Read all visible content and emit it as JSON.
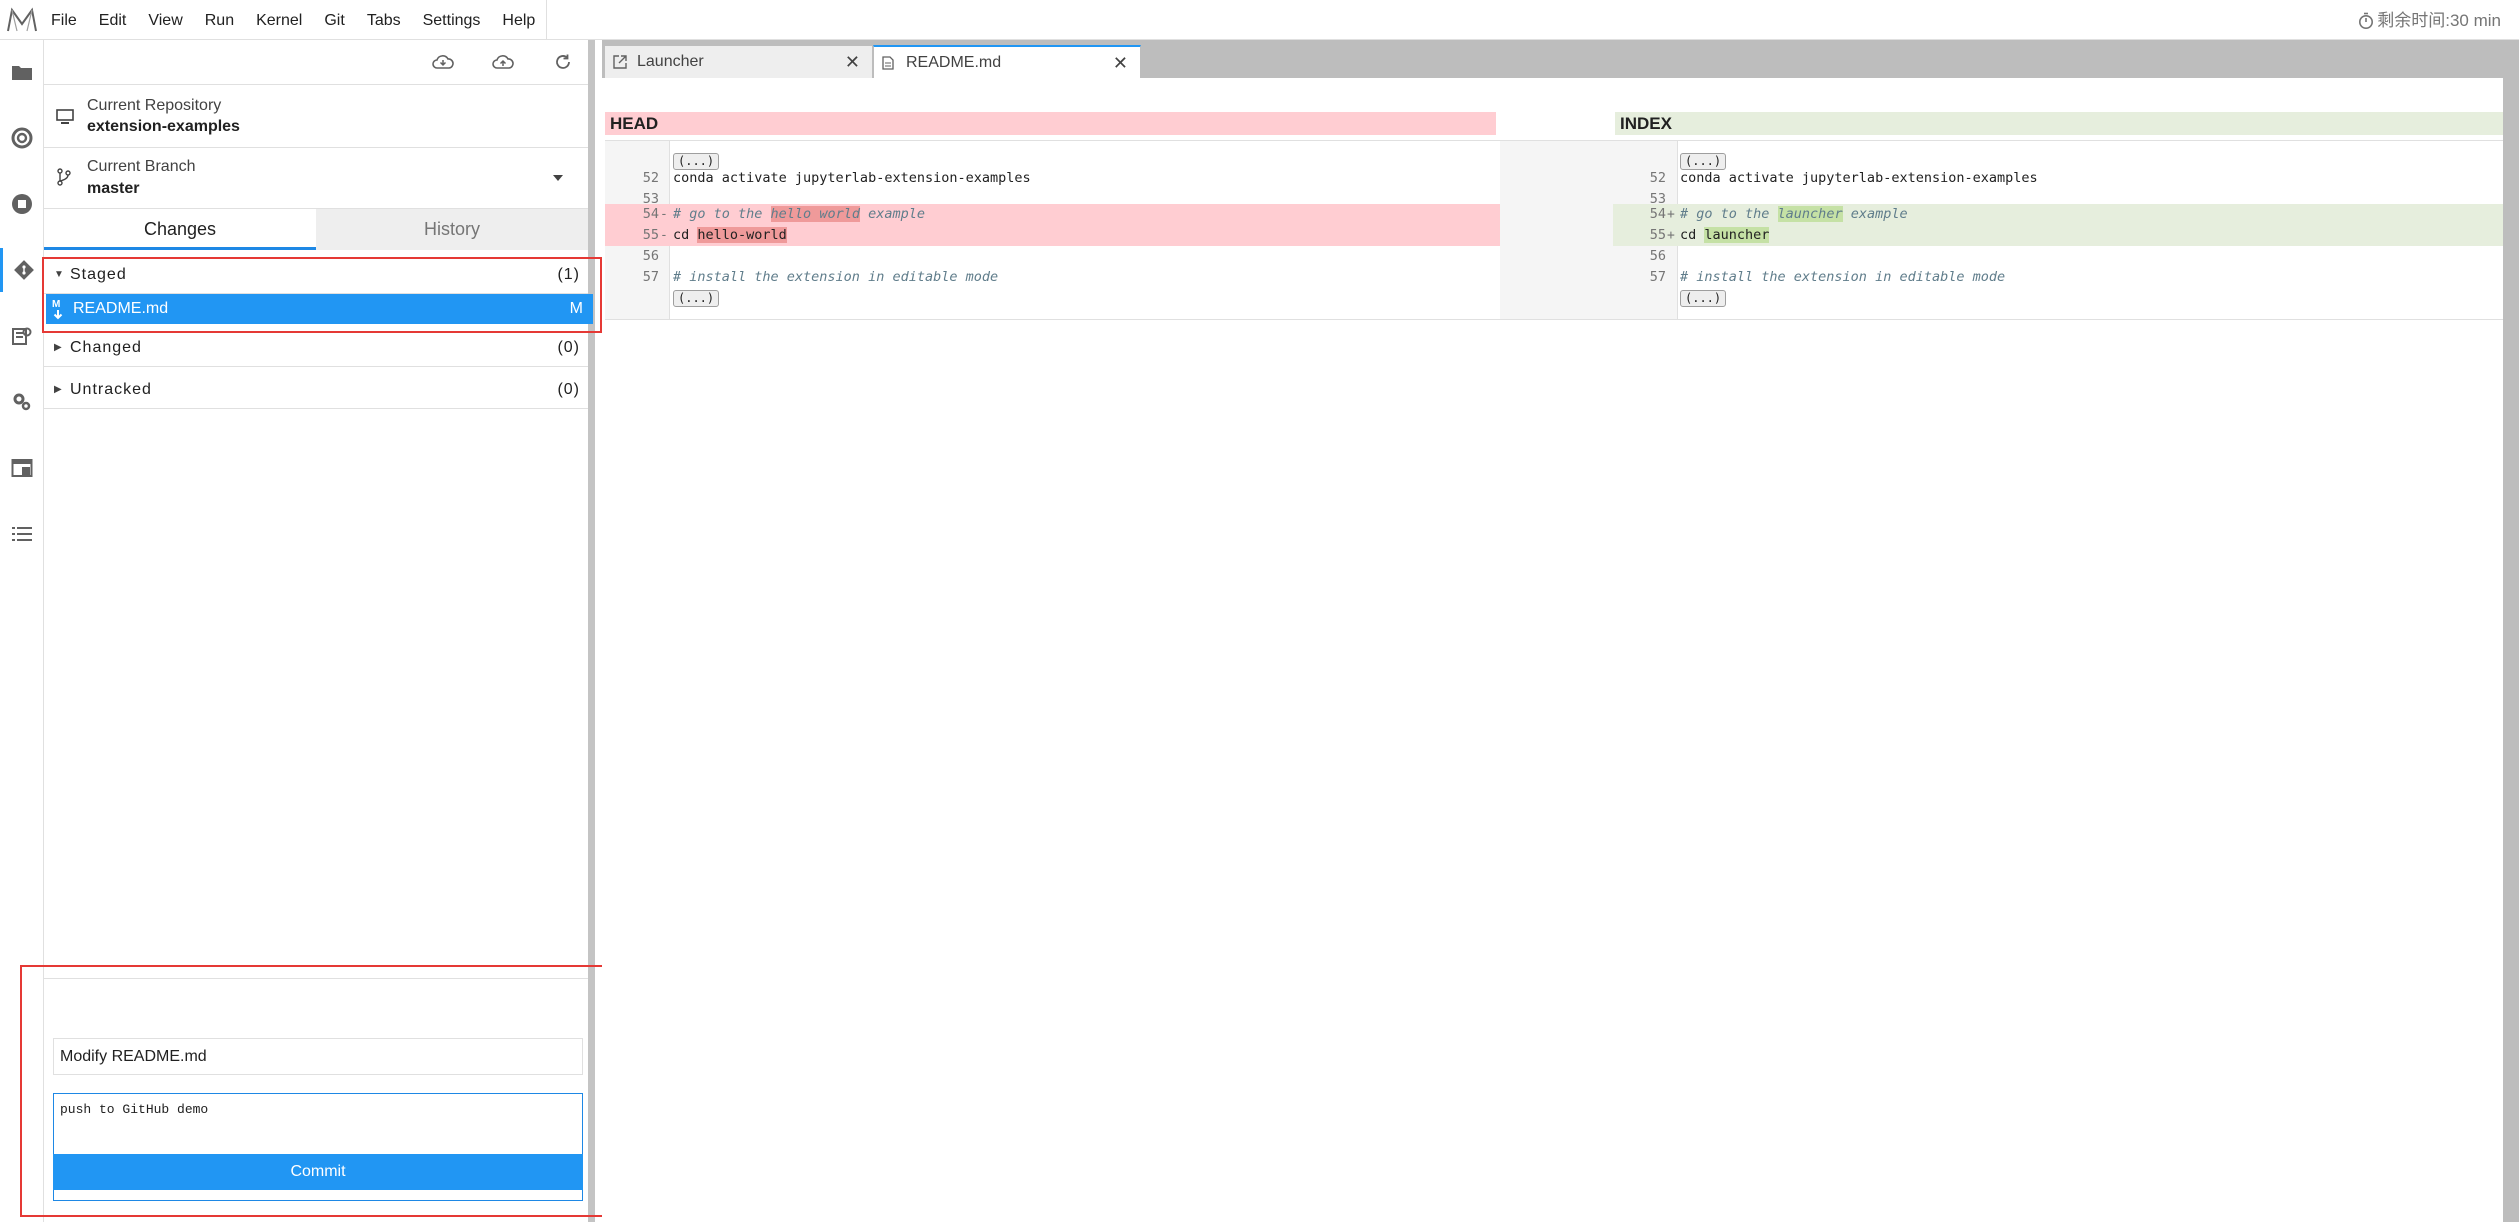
{
  "menubar": {
    "items": [
      "File",
      "Edit",
      "View",
      "Run",
      "Kernel",
      "Git",
      "Tabs",
      "Settings",
      "Help"
    ],
    "timer": "剩余时间:30 min"
  },
  "activitybar": {
    "icons": [
      "folder-icon",
      "running-icon",
      "stop-icon",
      "git-icon",
      "extension-manager-icon",
      "property-inspector-icon",
      "tabs-icon",
      "toc-icon"
    ]
  },
  "gitpanel": {
    "repo_label": "Current Repository",
    "repo_value": "extension-examples",
    "branch_label": "Current Branch",
    "branch_value": "master",
    "tabs": [
      "Changes",
      "History"
    ],
    "sections": {
      "staged": {
        "title": "Staged",
        "count": "(1)"
      },
      "changed": {
        "title": "Changed",
        "count": "(0)"
      },
      "untracked": {
        "title": "Untracked",
        "count": "(0)"
      }
    },
    "staged_file": {
      "name": "README.md",
      "status": "M",
      "icon_letter": "M"
    },
    "commit": {
      "summary": "Modify README.md",
      "description": "push to GitHub demo",
      "button": "Commit"
    }
  },
  "main": {
    "tabs": [
      {
        "label": "Launcher",
        "close": "✕"
      },
      {
        "label": "README.md",
        "close": "✕"
      }
    ],
    "diff": {
      "left_header": "HEAD",
      "right_header": "INDEX",
      "collapse_label": "(...)",
      "left_lines": [
        {
          "num": "52",
          "text": "conda activate jupyterlab-extension-examples"
        },
        {
          "num": "53",
          "text": ""
        },
        {
          "num": "54",
          "marker": "-",
          "pre": "# go to the ",
          "hl": "hello world",
          "post": " example"
        },
        {
          "num": "55",
          "marker": "-",
          "pre": "cd ",
          "hl": "hello-world",
          "post": ""
        },
        {
          "num": "56",
          "text": ""
        },
        {
          "num": "57",
          "text": "# install the extension in editable mode"
        }
      ],
      "right_lines": [
        {
          "num": "52",
          "text": "conda activate jupyterlab-extension-examples"
        },
        {
          "num": "53",
          "text": ""
        },
        {
          "num": "54",
          "marker": "+",
          "pre": "# go to the ",
          "hl": "launcher",
          "post": " example"
        },
        {
          "num": "55",
          "marker": "+",
          "pre": "cd ",
          "hl": "launcher",
          "post": ""
        },
        {
          "num": "56",
          "text": ""
        },
        {
          "num": "57",
          "text": "# install the extension in editable mode"
        }
      ]
    }
  },
  "colors": {
    "accent": "#2196f3",
    "deleted_bg": "#ffcdd2",
    "added_bg": "#e6eedd",
    "annotation_box": "#e53935"
  }
}
